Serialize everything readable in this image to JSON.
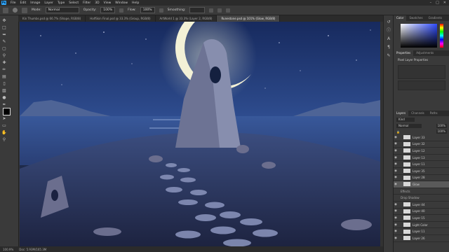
{
  "menubar": {
    "logo": "Ps",
    "items": [
      "File",
      "Edit",
      "Image",
      "Layer",
      "Type",
      "Select",
      "Filter",
      "3D",
      "View",
      "Window",
      "Help"
    ]
  },
  "options": {
    "mode_label": "Mode:",
    "mode_value": "Normal",
    "opacity_label": "Opacity:",
    "opacity_value": "100%",
    "flow_label": "Flow:",
    "flow_value": "100%",
    "smoothing_label": "Smoothing:"
  },
  "tabs": [
    {
      "label": "Kin Thumbs.psd @ 66.7% (Shape, RGB/8)"
    },
    {
      "label": "HalfSkin Final.psd @ 33.3% (Group, RGB/8)"
    },
    {
      "label": "ArtWorld 1 @ 33.3% (Layer 2, RGB/8)"
    },
    {
      "label": "Runestone.psd @ 101% (Glow, RGB/8)"
    }
  ],
  "status": {
    "zoom": "100.9%",
    "doc": "Doc: 5.93M/165.3M"
  },
  "panels": {
    "color_tabs": [
      "Color",
      "Swatches",
      "Gradients"
    ],
    "properties_tabs": [
      "Properties",
      "Adjustments"
    ],
    "properties_title": "Pixel Layer Properties",
    "layers_tabs": [
      "Layers",
      "Channels",
      "Paths"
    ],
    "search_placeholder": "Kind",
    "blend_mode": "Normal",
    "opacity_value": "100%",
    "fill_value": "100%",
    "layers": [
      {
        "name": "Layer 33",
        "selected": false,
        "sub": false
      },
      {
        "name": "Layer 32",
        "selected": false,
        "sub": false
      },
      {
        "name": "Layer 12",
        "selected": false,
        "sub": false
      },
      {
        "name": "Layer 13",
        "selected": false,
        "sub": false
      },
      {
        "name": "Layer 11",
        "selected": false,
        "sub": false
      },
      {
        "name": "Layer 35",
        "selected": false,
        "sub": false
      },
      {
        "name": "Layer 28",
        "selected": false,
        "sub": false
      },
      {
        "name": "Glow",
        "selected": true,
        "sub": false
      },
      {
        "name": "Effects",
        "selected": false,
        "sub": true
      },
      {
        "name": "Drop Shadow",
        "selected": false,
        "sub": true
      },
      {
        "name": "Layer 44",
        "selected": false,
        "sub": false
      },
      {
        "name": "Layer 40",
        "selected": false,
        "sub": false
      },
      {
        "name": "Layer 15",
        "selected": false,
        "sub": false
      },
      {
        "name": "Light Color",
        "selected": false,
        "sub": false
      },
      {
        "name": "Layer 11",
        "selected": false,
        "sub": false
      },
      {
        "name": "Layer 26",
        "selected": false,
        "sub": false
      }
    ]
  }
}
